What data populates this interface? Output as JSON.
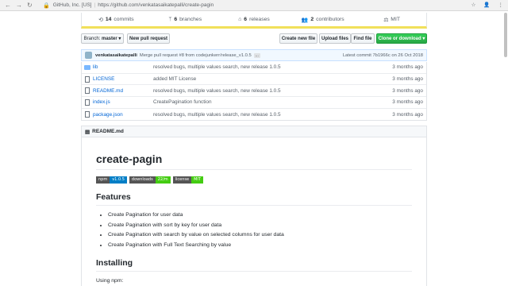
{
  "browser": {
    "origin": "GitHub, Inc. [US]",
    "url": "https://github.com/venkatasaikatepalli/create-pagin"
  },
  "summary": {
    "commits_count": "14",
    "commits_label": "commits",
    "branches_count": "6",
    "branches_label": "branches",
    "releases_count": "6",
    "releases_label": "releases",
    "contributors_count": "2",
    "contributors_label": "contributors",
    "license": "MIT"
  },
  "toolbar": {
    "branch_prefix": "Branch:",
    "branch_name": "master",
    "new_pull_request": "New pull request",
    "create_new_file": "Create new file",
    "upload_files": "Upload files",
    "find_file": "Find file",
    "clone_download": "Clone or download"
  },
  "commit": {
    "author": "venkatasaikatepalli",
    "message": "Merge pull request #8 from codejunkerr/release_v1.0.5",
    "ellipsis": "...",
    "latest": "Latest commit 7b1966c on 26 Oct 2018"
  },
  "files": [
    {
      "type": "folder",
      "name": "lib",
      "message": "resolved bugs, multiple values search, new release 1.0.5",
      "age": "3 months ago"
    },
    {
      "type": "file",
      "name": "LICENSE",
      "message": "added MIT License",
      "age": "3 months ago"
    },
    {
      "type": "file",
      "name": "README.md",
      "message": "resolved bugs, multiple values search, new release 1.0.5",
      "age": "3 months ago"
    },
    {
      "type": "file",
      "name": "index.js",
      "message": "CreatePagination function",
      "age": "3 months ago"
    },
    {
      "type": "file",
      "name": "package.json",
      "message": "resolved bugs, multiple values search, new release 1.0.5",
      "age": "3 months ago"
    }
  ],
  "readme": {
    "header": "README.md",
    "title": "create-pagin",
    "badges": [
      {
        "label": "npm",
        "value": "v1.0.5",
        "color": "#007ec6"
      },
      {
        "label": "downloads",
        "value": "22/m",
        "color": "#4c1"
      },
      {
        "label": "license",
        "value": "MIT",
        "color": "#4c1"
      }
    ],
    "features_heading": "Features",
    "features": [
      "Create Pagination for user data",
      "Create Pagination with sort by key for user data",
      "Create Pagination with search by value on selected columns for user data",
      "Create Pagination with Full Text Searching by value"
    ],
    "installing_heading": "Installing",
    "using_npm": "Using npm:"
  }
}
